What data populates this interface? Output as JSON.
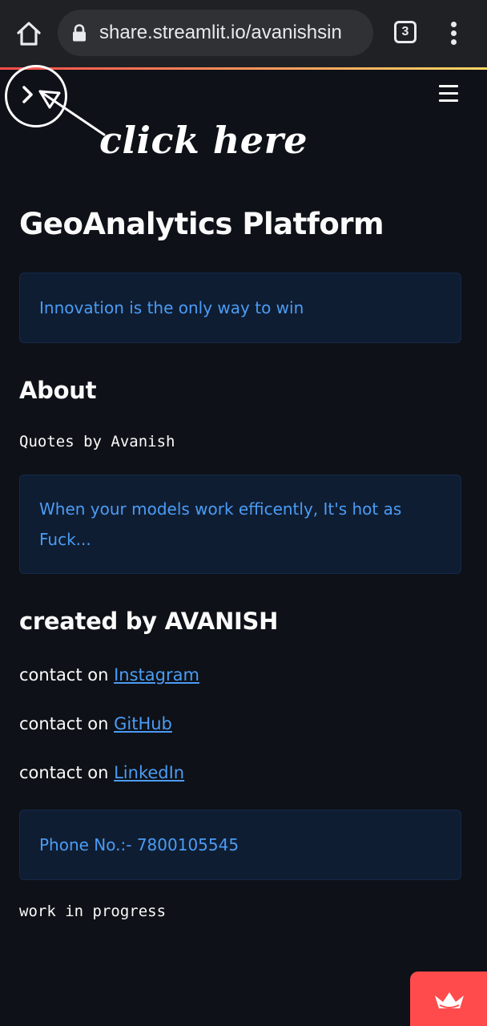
{
  "browser": {
    "url": "share.streamlit.io/avanishsin",
    "tab_count": "3",
    "icons": [
      "home-icon",
      "lock-icon",
      "tabs-icon",
      "more-vert-icon"
    ]
  },
  "app_header": {
    "sidebar_toggle_icon": "chevron-right-icon",
    "menu_icon": "hamburger-icon",
    "annotation_text": "click here"
  },
  "main": {
    "title": "GeoAnalytics Platform",
    "info_motto": "Innovation is the only way to win",
    "about_heading": "About",
    "quotes_by": "Quotes by Avanish",
    "quote": "When your models work efficently, It's hot as Fuck...",
    "created_heading": "created by AVANISH",
    "contacts": [
      {
        "prefix": "contact on ",
        "link": "Instagram"
      },
      {
        "prefix": "contact on ",
        "link": "GitHub"
      },
      {
        "prefix": "contact on ",
        "link": "LinkedIn"
      }
    ],
    "phone": "Phone No.:- 7800105545",
    "status": "work in progress"
  },
  "colors": {
    "background": "#0e1117",
    "info_bg": "#0f1d32",
    "info_text": "#4b9cf5",
    "link": "#4b9cf5",
    "badge": "#ff4b4b"
  }
}
